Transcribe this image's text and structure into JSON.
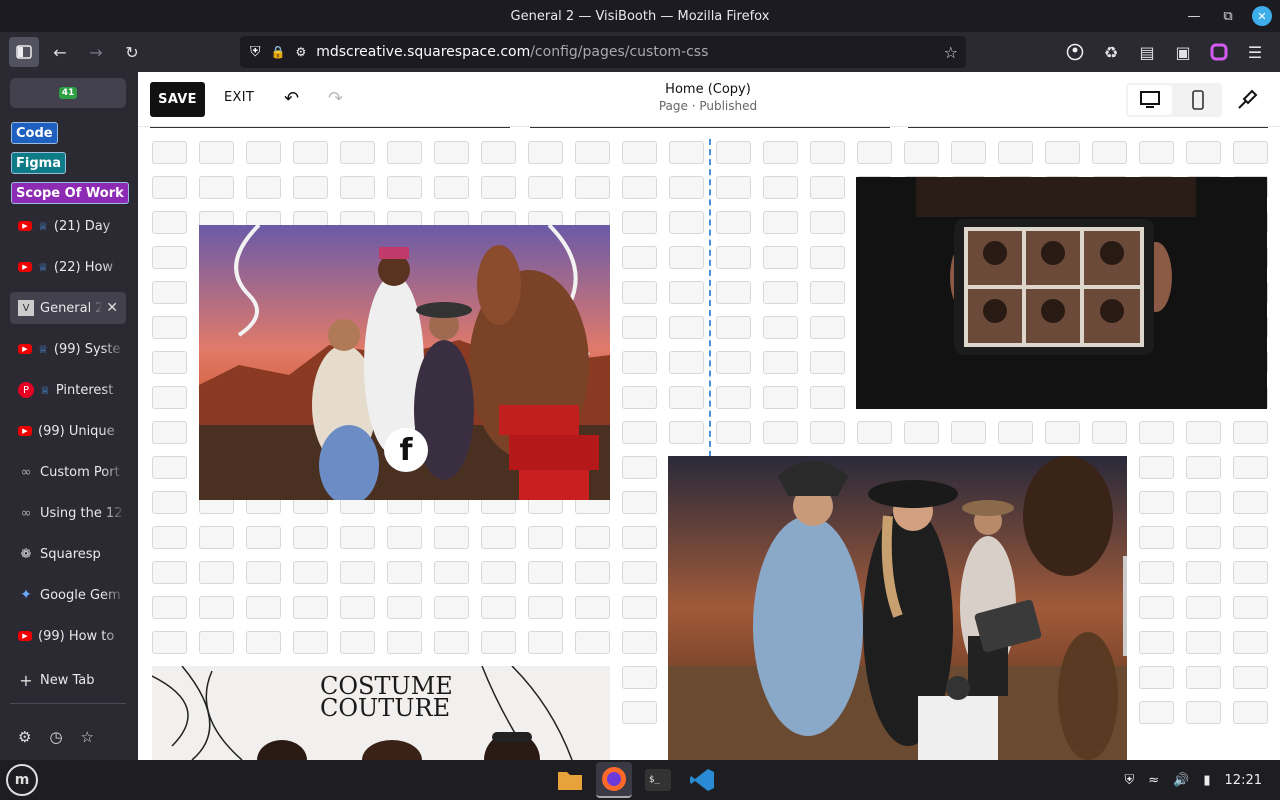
{
  "window": {
    "title": "General 2 — VisiBooth — Mozilla Firefox"
  },
  "browser": {
    "url_domain": "mdscreative.squarespace.com",
    "url_path": "/config/pages/custom-css",
    "extension_badge": "41"
  },
  "sidebar": {
    "tags": [
      {
        "label": "Code",
        "color": "#1f5fbf"
      },
      {
        "label": "Figma",
        "color": "#0e7c86"
      },
      {
        "label": "Scope Of Work",
        "color": "#8e2bb5"
      }
    ],
    "tabs": [
      {
        "label": "(21) Day",
        "icon": "youtube-icon"
      },
      {
        "label": "(22) How",
        "icon": "youtube-icon"
      },
      {
        "label": "General 2",
        "icon": "visibooth-icon",
        "active": true
      },
      {
        "label": "(99) Syste",
        "icon": "youtube-icon"
      },
      {
        "label": "Pinterest",
        "icon": "pinterest-icon"
      },
      {
        "label": "(99) Unique",
        "icon": "youtube-icon"
      },
      {
        "label": "Custom Port",
        "icon": "squarespace-icon"
      },
      {
        "label": "Using the 12",
        "icon": "squarespace-icon"
      },
      {
        "label": "Squaresp",
        "icon": "openai-icon"
      },
      {
        "label": "Google Gem",
        "icon": "gemini-icon"
      },
      {
        "label": "(99) How to",
        "icon": "youtube-icon"
      }
    ],
    "new_tab": "New Tab"
  },
  "editor": {
    "save": "SAVE",
    "exit": "EXIT",
    "page_title": "Home (Copy)",
    "page_status": "Page · Published"
  },
  "images": [
    {
      "name": "cowboy-photobooth-image",
      "alt": "Three people posing in western costume with horse statue"
    },
    {
      "name": "tablet-gallery-image",
      "alt": "Hands holding tablet showing photo grid"
    },
    {
      "name": "photobooth-event-image",
      "alt": "Women in cowboy hats using photobooth kiosk"
    },
    {
      "name": "costume-couture-image",
      "alt": "Costume Couture photo strip"
    }
  ],
  "costume_text": "COSTUME\nCOUTURE",
  "taskbar": {
    "clock": "12:21"
  }
}
